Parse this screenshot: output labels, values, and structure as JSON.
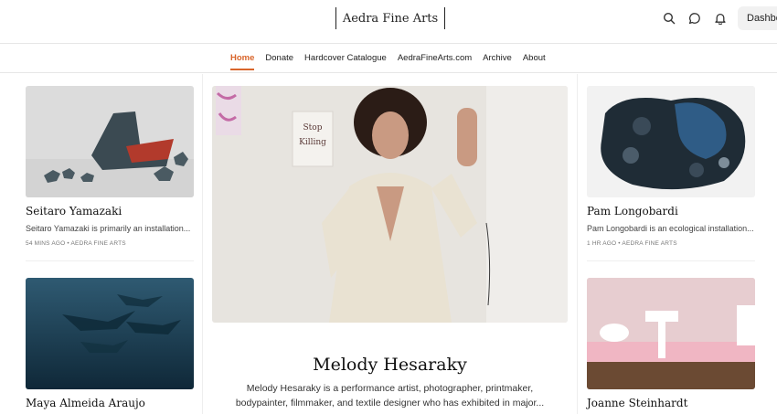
{
  "header": {
    "brand": "Aedra Fine Arts",
    "dashboard_label": "Dashbo",
    "icons": [
      "search-icon",
      "chat-icon",
      "bell-icon"
    ]
  },
  "nav": {
    "items": [
      {
        "label": "Home",
        "active": true
      },
      {
        "label": "Donate"
      },
      {
        "label": "Hardcover Catalogue"
      },
      {
        "label": "AedraFineArts.com"
      },
      {
        "label": "Archive"
      },
      {
        "label": "About"
      }
    ]
  },
  "posts": {
    "left_top": {
      "title": "Seitaro Yamazaki",
      "excerpt": "Seitaro Yamazaki is primarily an installation...",
      "meta": "54 MINS AGO • AEDRA FINE ARTS"
    },
    "left_bottom": {
      "title": "Maya Almeida Araujo"
    },
    "featured": {
      "title": "Melody Hesaraky",
      "excerpt": "Melody Hesaraky is a performance artist, photographer, printmaker, bodypainter, filmmaker, and textile designer who has exhibited in major...",
      "sign_text": "Stop Killing"
    },
    "right_top": {
      "title": "Pam Longobardi",
      "excerpt": "Pam Longobardi is an ecological installation...",
      "meta": "1 HR AGO • AEDRA FINE ARTS"
    },
    "right_bottom": {
      "title": "Joanne Steinhardt"
    }
  },
  "colors": {
    "accent": "#d9652b",
    "text": "#1a1a1a",
    "muted": "#777777",
    "border": "#e6e6e6"
  }
}
